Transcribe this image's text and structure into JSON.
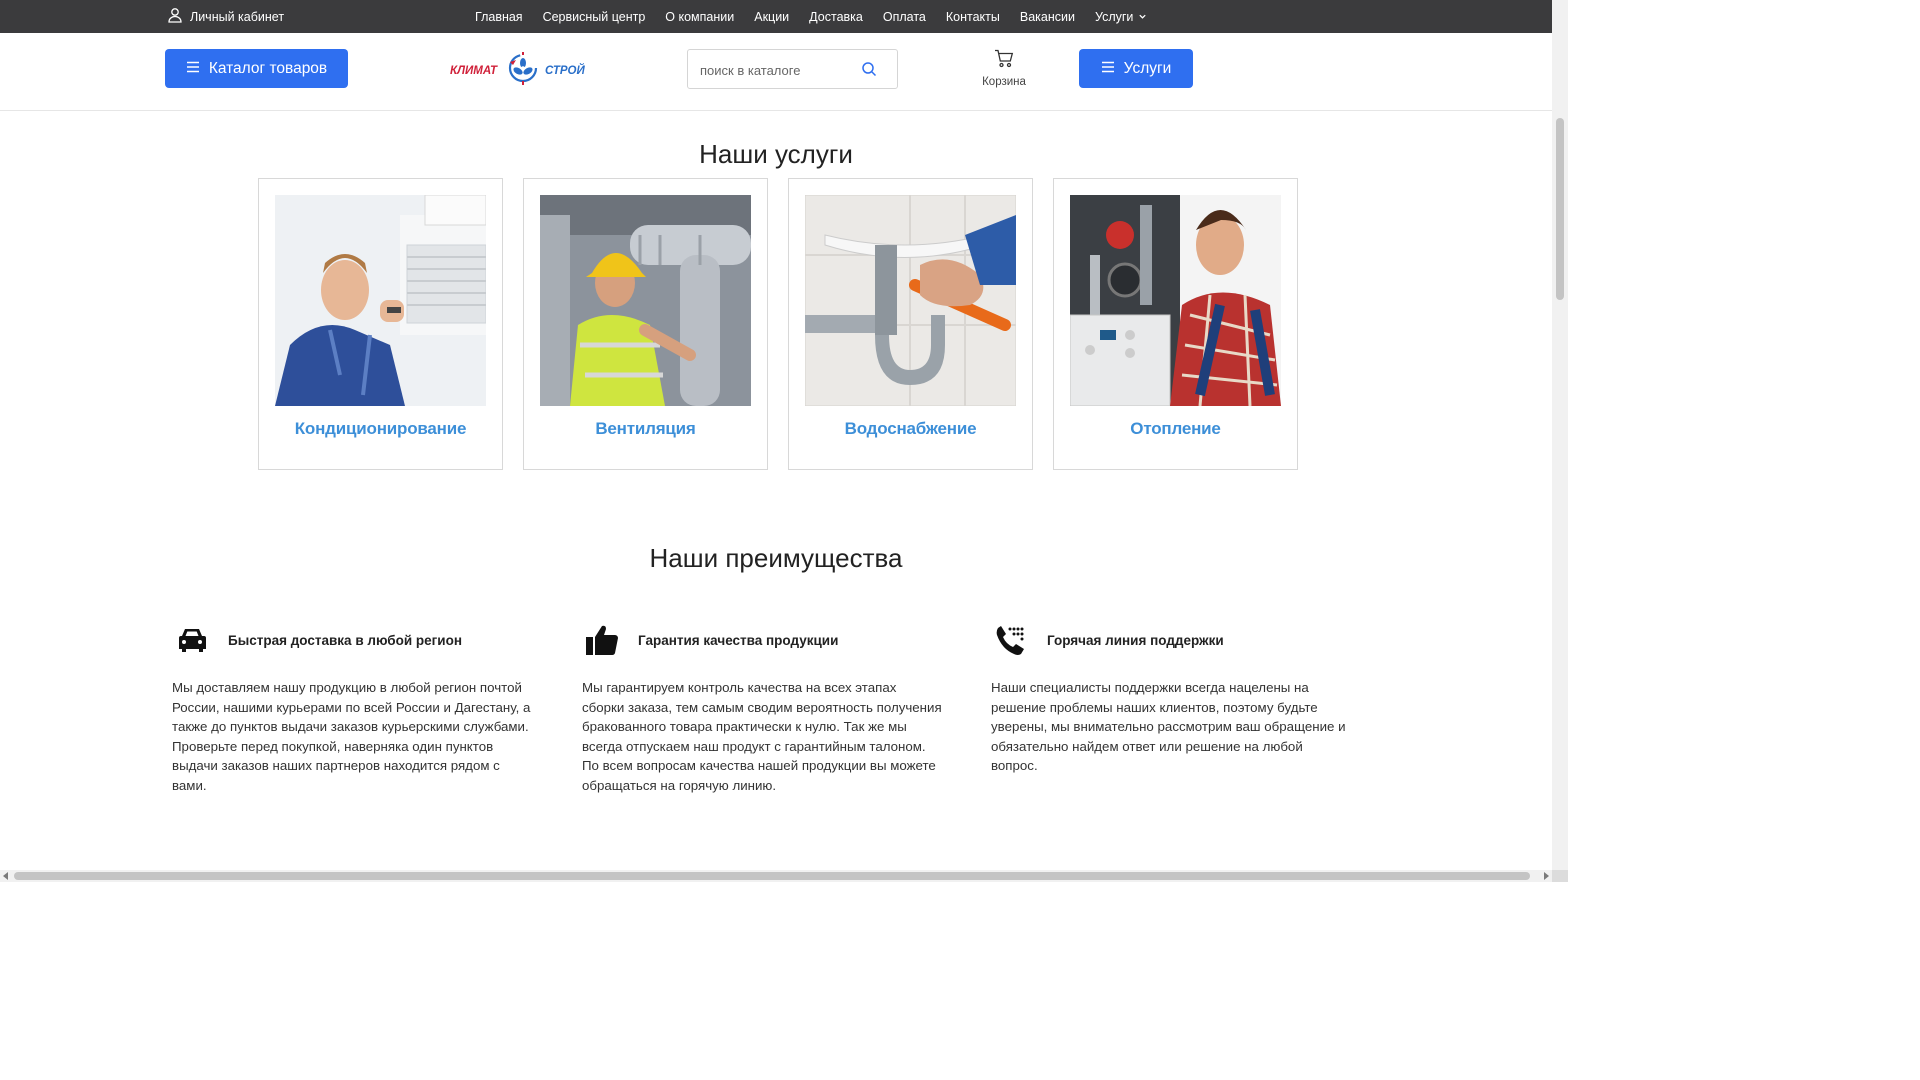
{
  "topbar": {
    "account_label": "Личный кабинет",
    "nav": [
      "Главная",
      "Сервисный центр",
      "О компании",
      "Акции",
      "Доставка",
      "Оплата",
      "Контакты",
      "Вакансии"
    ],
    "services_dropdown": "Услуги"
  },
  "header": {
    "catalog_button": "Каталог товаров",
    "logo_text_left": "КЛИМАТ",
    "logo_text_right": "СТРОЙ",
    "search_placeholder": "поиск в каталоге",
    "cart_label": "Корзина",
    "services_button": "Услуги"
  },
  "services": {
    "heading": "Наши услуги",
    "items": [
      {
        "title": "Кондиционирование",
        "icon": "air-conditioning-photo"
      },
      {
        "title": "Вентиляция",
        "icon": "ventilation-photo"
      },
      {
        "title": "Водоснабжение",
        "icon": "water-supply-photo"
      },
      {
        "title": "Отопление",
        "icon": "heating-photo"
      }
    ]
  },
  "advantages": {
    "heading": "Наши преимущества",
    "items": [
      {
        "title": "Быстрая доставка в любой регион",
        "icon": "car-icon",
        "text": "Мы доставляем нашу продукцию в любой регион почтой России, нашими курьерами по всей России и Дагестану, а также до пунктов выдачи заказов курьерскими службами. Проверьте перед покупкой, наверняка один пунктов выдачи заказов наших партнеров находится рядом с вами."
      },
      {
        "title": "Гарантия качества продукции",
        "icon": "thumbs-up-icon",
        "text": "Мы гарантируем контроль качества на всех этапах сборки заказа, тем самым сводим вероятность получения бракованного товара практически к нулю. Так же мы всегда отпускаем наш продукт с гарантийным талоном. По всем вопросам качества нашей продукции вы можете обращаться на горячую линию."
      },
      {
        "title": "Горячая линия поддержки",
        "icon": "phone-icon",
        "text": "Наши специалисты поддержки всегда нацелены на решение проблемы наших клиентов, поэтому будьте уверены, мы внимательно рассмотрим ваш обращение и обязательно найдем ответ или решение на любой вопрос."
      }
    ]
  },
  "colors": {
    "topbar_bg": "#3b3b3d",
    "accent_blue": "#2f6ff0",
    "card_title": "#3d8fd8",
    "logo_red": "#d0213a",
    "logo_blue": "#2a6fc9"
  }
}
